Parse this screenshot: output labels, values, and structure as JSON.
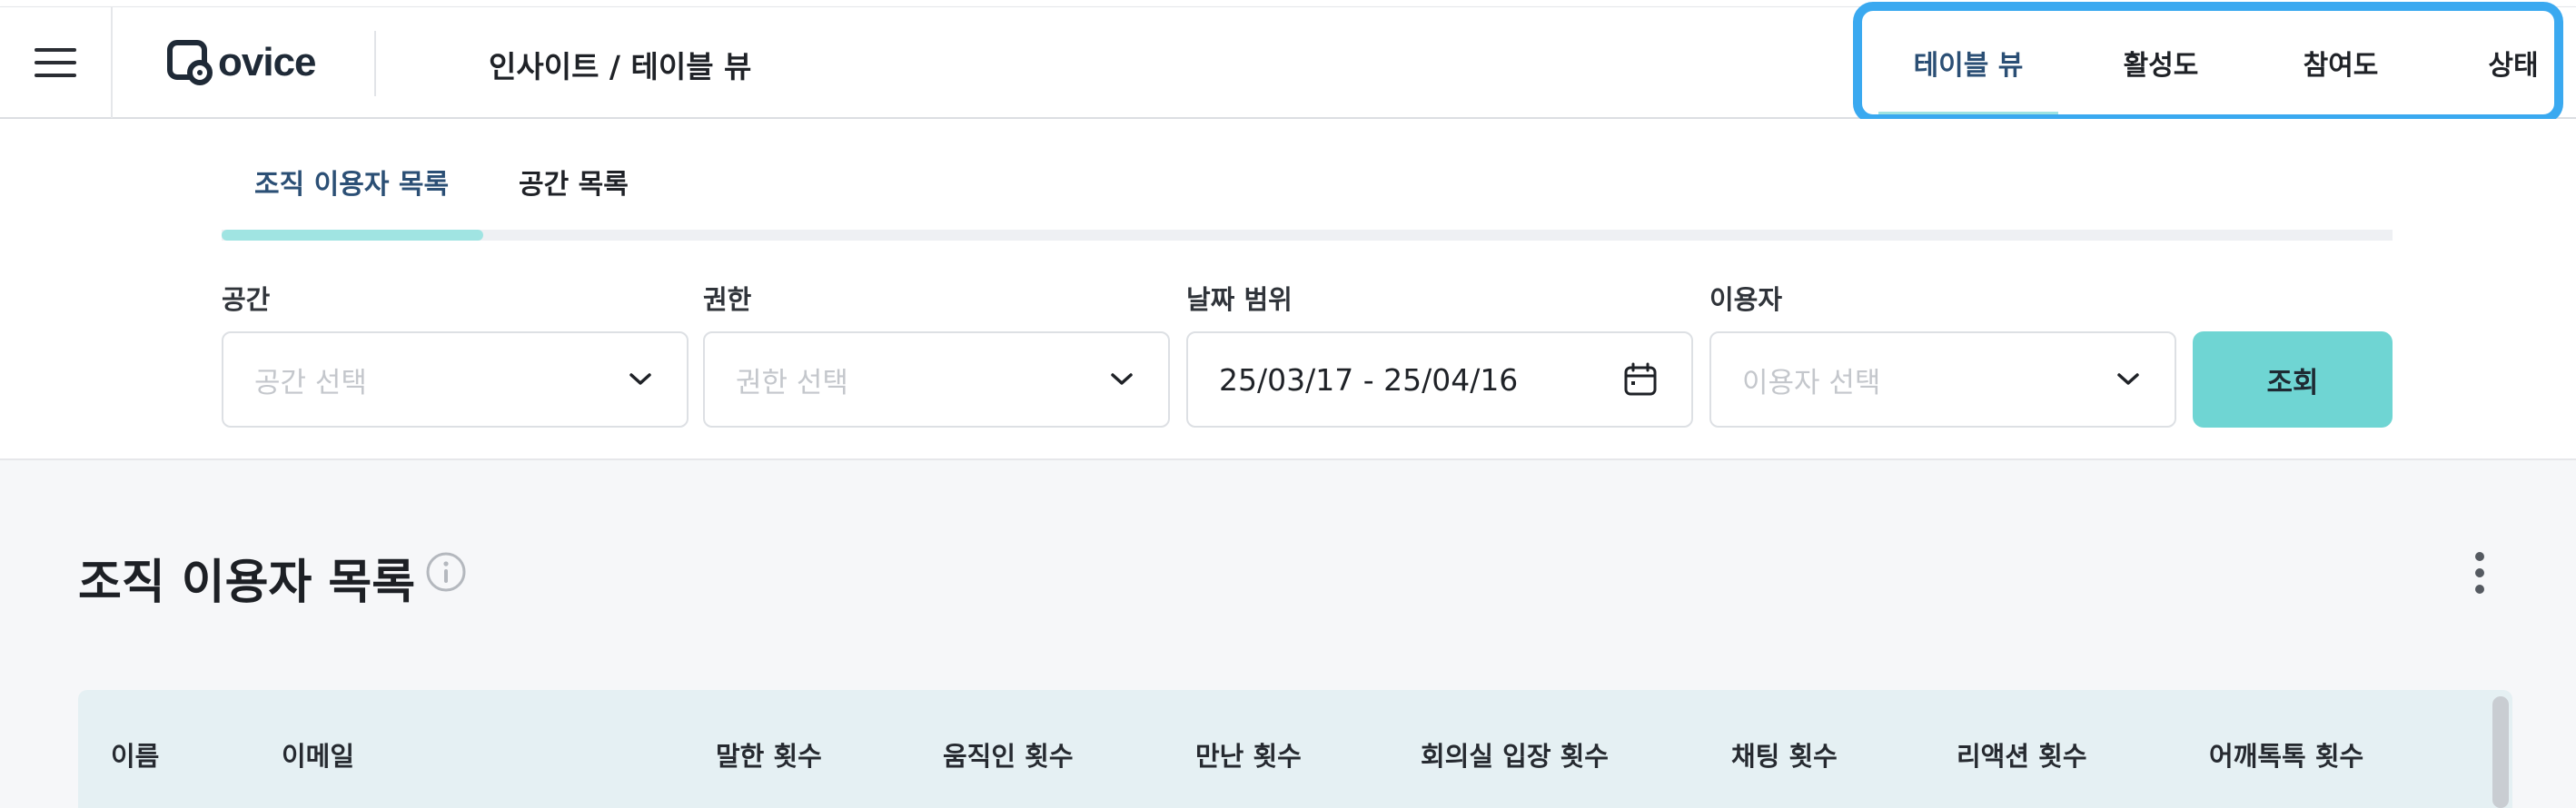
{
  "header": {
    "logo_text": "ovice",
    "breadcrumb": "인사이트 / 테이블 뷰",
    "nav_tabs": [
      {
        "label": "테이블 뷰",
        "active": true
      },
      {
        "label": "활성도",
        "active": false
      },
      {
        "label": "참여도",
        "active": false
      },
      {
        "label": "상태",
        "active": false
      }
    ]
  },
  "sub_tabs": [
    {
      "label": "조직 이용자 목록",
      "active": true
    },
    {
      "label": "공간 목록",
      "active": false
    }
  ],
  "filters": {
    "space": {
      "label": "공간",
      "placeholder": "공간 선택"
    },
    "role": {
      "label": "권한",
      "placeholder": "권한 선택"
    },
    "date": {
      "label": "날짜 범위",
      "value": "25/03/17 - 25/04/16"
    },
    "user": {
      "label": "이용자",
      "placeholder": "이용자 선택"
    },
    "search_label": "조회"
  },
  "section": {
    "title": "조직 이용자 목록"
  },
  "table": {
    "columns": [
      "이름",
      "이메일",
      "말한 횟수",
      "움직인 횟수",
      "만난 횟수",
      "회의실 입장 횟수",
      "채팅 횟수",
      "리액션 횟수",
      "어깨톡톡 횟수"
    ]
  },
  "colors": {
    "accent": "#6fd5d3",
    "active_tab_text": "#2b4f75",
    "highlight": "#3aa9f0"
  }
}
